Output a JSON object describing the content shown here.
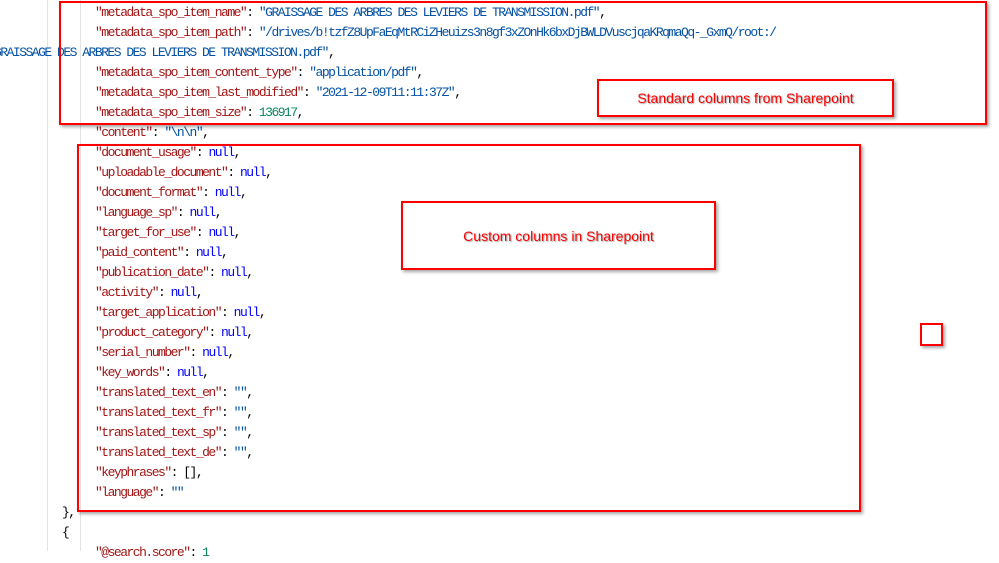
{
  "colors": {
    "key": "#a31515",
    "string": "#0451a5",
    "number": "#098658",
    "null": "#0000ff",
    "annotation": "#ff0000"
  },
  "code": {
    "standard_fields": [
      {
        "key": "\"metadata_spo_item_name\"",
        "value": "\"GRAISSAGE DES ARBRES DES LEVIERS DE TRANSMISSION.pdf\"",
        "type": "s",
        "end": ","
      },
      {
        "key": "\"metadata_spo_item_path\"",
        "value": "\"/drives/b!tzfZ8UpFaEqMtRCiZHeuizs3n8gf3xZOnHk6bxDjBWLDVuscjqaKRqmaQq-_GxmQ/root:/",
        "type": "s",
        "end": ""
      },
      {
        "key": "",
        "value": "GRAISSAGE DES ARBRES DES LEVIERS DE TRANSMISSION.pdf\"",
        "type": "s",
        "end": ",",
        "wrap": true
      },
      {
        "key": "\"metadata_spo_item_content_type\"",
        "value": "\"application/pdf\"",
        "type": "s",
        "end": ","
      },
      {
        "key": "\"metadata_spo_item_last_modified\"",
        "value": "\"2021-12-09T11:11:37Z\"",
        "type": "s",
        "end": ","
      },
      {
        "key": "\"metadata_spo_item_size\"",
        "value": "136917",
        "type": "n",
        "end": ","
      },
      {
        "key": "\"content\"",
        "value": "\"\\n\\n\"",
        "type": "s",
        "end": ","
      }
    ],
    "custom_fields": [
      {
        "key": "\"document_usage\"",
        "value": "null",
        "type": "nl",
        "end": ","
      },
      {
        "key": "\"uploadable_document\"",
        "value": "null",
        "type": "nl",
        "end": ","
      },
      {
        "key": "\"document_format\"",
        "value": "null",
        "type": "nl",
        "end": ","
      },
      {
        "key": "\"language_sp\"",
        "value": "null",
        "type": "nl",
        "end": ","
      },
      {
        "key": "\"target_for_use\"",
        "value": "null",
        "type": "nl",
        "end": ","
      },
      {
        "key": "\"paid_content\"",
        "value": "null",
        "type": "nl",
        "end": ","
      },
      {
        "key": "\"publication_date\"",
        "value": "null",
        "type": "nl",
        "end": ","
      },
      {
        "key": "\"activity\"",
        "value": "null",
        "type": "nl",
        "end": ","
      },
      {
        "key": "\"target_application\"",
        "value": "null",
        "type": "nl",
        "end": ","
      },
      {
        "key": "\"product_category\"",
        "value": "null",
        "type": "nl",
        "end": ","
      },
      {
        "key": "\"serial_number\"",
        "value": "null",
        "type": "nl",
        "end": ","
      },
      {
        "key": "\"key_words\"",
        "value": "null",
        "type": "nl",
        "end": ","
      },
      {
        "key": "\"translated_text_en\"",
        "value": "\"\"",
        "type": "s",
        "end": ","
      },
      {
        "key": "\"translated_text_fr\"",
        "value": "\"\"",
        "type": "s",
        "end": ","
      },
      {
        "key": "\"translated_text_sp\"",
        "value": "\"\"",
        "type": "s",
        "end": ","
      },
      {
        "key": "\"translated_text_de\"",
        "value": "\"\"",
        "type": "s",
        "end": ","
      },
      {
        "key": "\"keyphrases\"",
        "value": "[]",
        "type": "p",
        "end": ","
      },
      {
        "key": "\"language\"",
        "value": "\"\"",
        "type": "s",
        "end": ""
      }
    ],
    "close_brace": "},",
    "open_brace": "{",
    "next_line": {
      "key": "\"@search.score\"",
      "value": "1",
      "type": "n",
      "end": ""
    }
  },
  "annotations": {
    "standard_label": "Standard columns from Sharepoint",
    "custom_label": "Custom columns in Sharepoint"
  }
}
